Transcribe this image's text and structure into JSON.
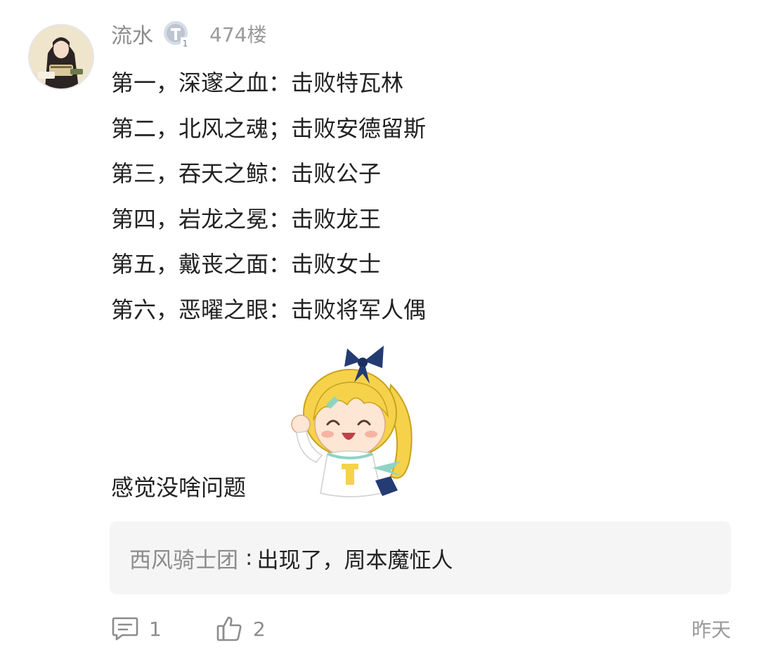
{
  "post": {
    "author": "流水",
    "level_badge": "T1",
    "floor": "474楼",
    "lines": [
      "第一，深邃之血：击败特瓦林",
      "第二，北风之魂；击败安德留斯",
      "第三，吞天之鲸：击败公子",
      "第四，岩龙之冕：击败龙王",
      "第五，戴丧之面：击败女士",
      "第六，恶曜之眼：击败将军人偶"
    ],
    "closing": "感觉没啥问题"
  },
  "reply": {
    "author": "西风骑士团",
    "separator": ":",
    "text": "出现了，周本魔怔人"
  },
  "footer": {
    "comment_count": "1",
    "like_count": "2",
    "timestamp": "昨天"
  },
  "icons": {
    "avatar": "avatar-girl-icon",
    "level": "level-badge-icon",
    "sticker": "anime-girl-sticker",
    "comment": "comment-icon",
    "like": "thumbs-up-icon"
  },
  "colors": {
    "text": "#222222",
    "muted": "#8c8c8c",
    "reply_bg": "#f5f5f5"
  }
}
